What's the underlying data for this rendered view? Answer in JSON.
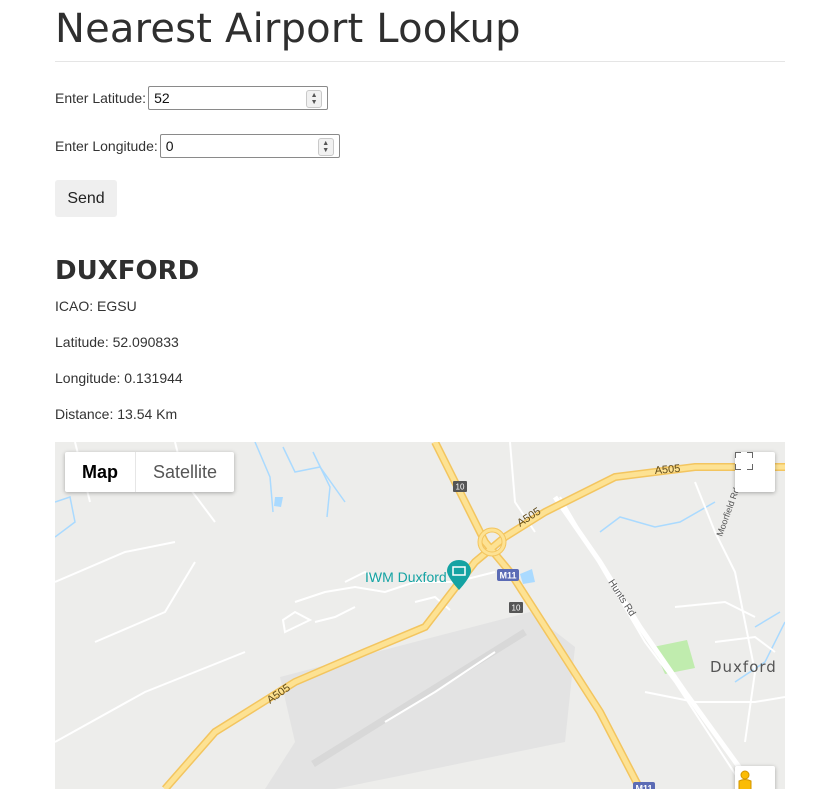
{
  "page": {
    "title": "Nearest Airport Lookup"
  },
  "form": {
    "latitude_label": "Enter Latitude:",
    "latitude_value": "52",
    "longitude_label": "Enter Longitude:",
    "longitude_value": "0",
    "send_label": "Send"
  },
  "result": {
    "name": "DUXFORD",
    "icao": "ICAO: EGSU",
    "latitude": "Latitude: 52.090833",
    "longitude": "Longitude: 0.131944",
    "distance": "Distance: 13.54 Km"
  },
  "map": {
    "type_map": "Map",
    "type_satellite": "Satellite",
    "poi_label": "IWM Duxford",
    "town_label": "Duxford",
    "road_a505": "A505",
    "road_hunts": "Hunts Rd",
    "road_moorfield": "Moorfield Rd",
    "motorway_shield": "M11",
    "junction_number": "10",
    "icons": [
      "fullscreen-icon",
      "pegman-icon",
      "museum-pin-icon"
    ],
    "colors": {
      "land": "#ededeb",
      "major_road": "#fbd573",
      "water": "#aadaff",
      "park": "#c0ecae",
      "poi": "#14a3a3"
    }
  }
}
